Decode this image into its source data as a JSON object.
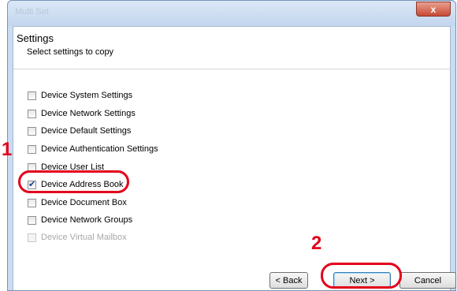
{
  "window": {
    "title": "Multi Set",
    "close_glyph": "x"
  },
  "header": {
    "title": "Settings",
    "subtitle": "Select settings to copy"
  },
  "options": [
    {
      "label": "Device System Settings",
      "checked": false,
      "enabled": true
    },
    {
      "label": "Device Network Settings",
      "checked": false,
      "enabled": true
    },
    {
      "label": "Device Default Settings",
      "checked": false,
      "enabled": true
    },
    {
      "label": "Device Authentication Settings",
      "checked": false,
      "enabled": true
    },
    {
      "label": "Device User List",
      "checked": false,
      "enabled": true
    },
    {
      "label": "Device Address Book",
      "checked": true,
      "enabled": true
    },
    {
      "label": "Device Document Box",
      "checked": false,
      "enabled": true
    },
    {
      "label": "Device Network Groups",
      "checked": false,
      "enabled": true
    },
    {
      "label": "Device Virtual Mailbox",
      "checked": false,
      "enabled": false
    }
  ],
  "buttons": {
    "back": "< Back",
    "next": "Next >",
    "cancel": "Cancel"
  },
  "callouts": {
    "step1": "1",
    "step2": "2"
  },
  "colors": {
    "callout": "#e3001b"
  }
}
